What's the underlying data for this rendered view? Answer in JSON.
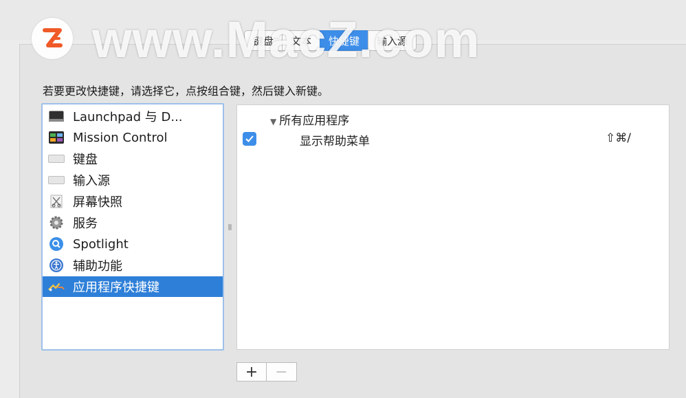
{
  "tabs": [
    {
      "label": "键盘",
      "active": false
    },
    {
      "label": "文本",
      "active": false
    },
    {
      "label": "快捷键",
      "active": true
    },
    {
      "label": "输入源",
      "active": false
    }
  ],
  "watermark": {
    "text": "www.MacZ.com",
    "logo_letter": "Z",
    "logo_color": "#f05a28"
  },
  "instruction": "若要更改快捷键，请选择它，点按组合键，然后键入新键。",
  "sidebar": {
    "items": [
      {
        "label": "Launchpad 与 D...",
        "icon": "launchpad-icon"
      },
      {
        "label": "Mission Control",
        "icon": "mission-control-icon"
      },
      {
        "label": "键盘",
        "icon": "keyboard-icon"
      },
      {
        "label": "输入源",
        "icon": "input-source-icon"
      },
      {
        "label": "屏幕快照",
        "icon": "screenshot-icon"
      },
      {
        "label": "服务",
        "icon": "gear-icon"
      },
      {
        "label": "Spotlight",
        "icon": "spotlight-icon"
      },
      {
        "label": "辅助功能",
        "icon": "accessibility-icon"
      },
      {
        "label": "应用程序快捷键",
        "icon": "app-shortcuts-icon",
        "selected": true
      }
    ]
  },
  "detail": {
    "group_label": "所有应用程序",
    "rows": [
      {
        "label": "显示帮助菜单",
        "keys": "⇧⌘/",
        "checked": true
      }
    ]
  },
  "buttons": {
    "add": "+",
    "remove": "−"
  },
  "colors": {
    "accent": "#3d8ee9",
    "selection": "#2e7fd8",
    "list_border": "#9cc0ea"
  }
}
